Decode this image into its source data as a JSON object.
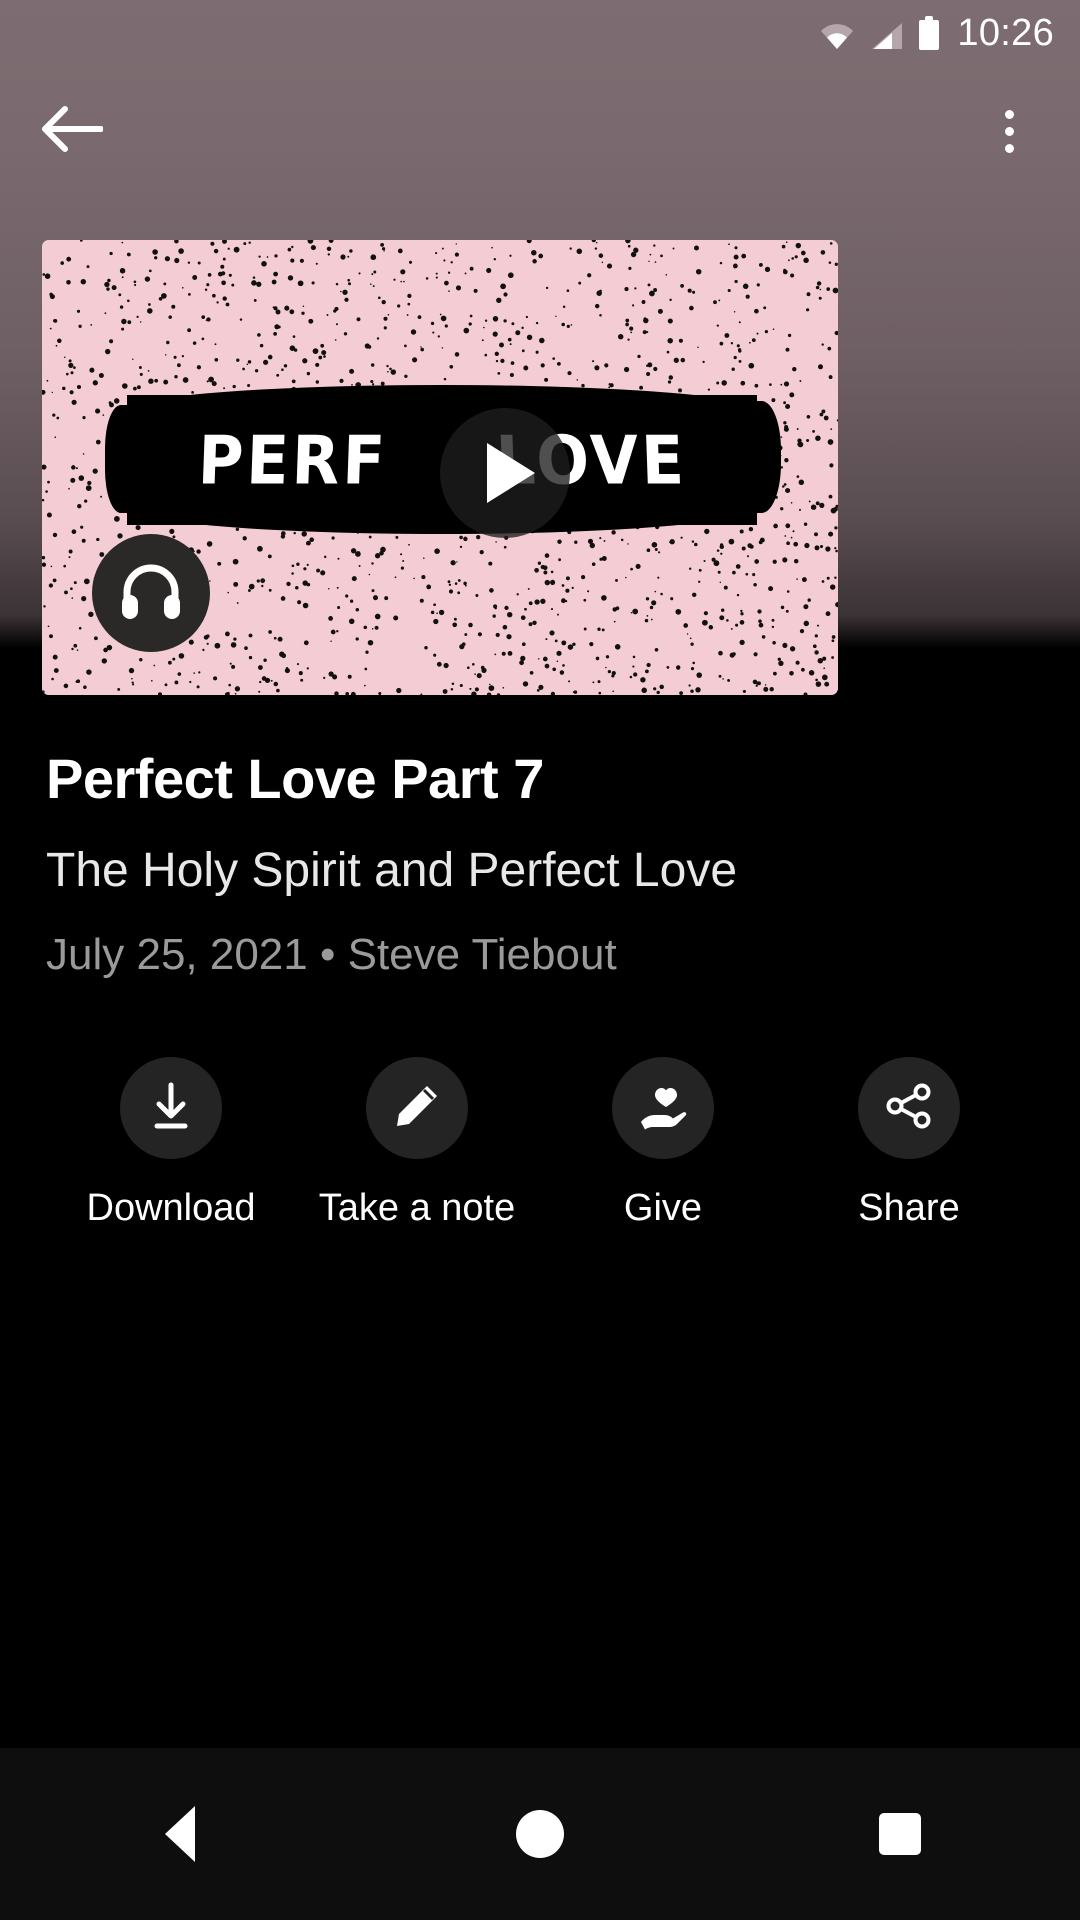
{
  "status_bar": {
    "time": "10:26",
    "icons": [
      "wifi-icon",
      "cellular-signal-icon",
      "battery-icon"
    ]
  },
  "app_bar": {
    "back_icon": "back-arrow-icon",
    "overflow_icon": "more-vertical-icon"
  },
  "artwork": {
    "word_left": "PERF",
    "word_right": "LOVE",
    "full_text": "PERFECT LOVE",
    "background_color": "#f4ccd4",
    "band_color": "#000000",
    "play_icon": "play-icon",
    "audio_badge_icon": "headphones-icon"
  },
  "episode": {
    "title": "Perfect Love Part 7",
    "subtitle": "The Holy Spirit and Perfect Love",
    "meta": "July 25, 2021 • Steve Tiebout",
    "date": "July 25, 2021",
    "speaker": "Steve Tiebout"
  },
  "actions": [
    {
      "label": "Download",
      "icon": "download-icon"
    },
    {
      "label": "Take a note",
      "icon": "pencil-icon"
    },
    {
      "label": "Give",
      "icon": "hand-heart-icon"
    },
    {
      "label": "Share",
      "icon": "share-icon"
    }
  ],
  "nav_bar": {
    "back": "nav-back-icon",
    "home": "nav-home-icon",
    "recents": "nav-recents-icon"
  }
}
